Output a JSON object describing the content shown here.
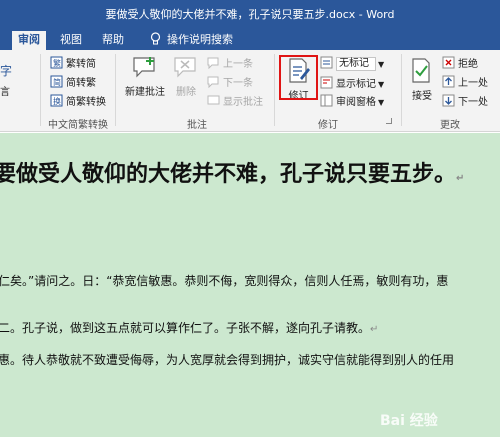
{
  "window": {
    "title": "要做受人敬仰的大佬并不难，孔子说只要五步.docx - Word"
  },
  "tabs": [
    {
      "label": "审阅",
      "active": true
    },
    {
      "label": "视图",
      "active": false
    },
    {
      "label": "帮助",
      "active": false
    }
  ],
  "tell_me": "操作说明搜索",
  "ribbon": {
    "left_partial": {
      "top": "字",
      "bottom": "言"
    },
    "chinese_conversion": {
      "items": [
        "繁转简",
        "简转繁",
        "简繁转换"
      ],
      "label": "中文简繁转换"
    },
    "comments": {
      "new_comment": "新建批注",
      "delete": "删除",
      "previous": "上一条",
      "next": "下一条",
      "show_comments": "显示批注",
      "label": "批注"
    },
    "tracking": {
      "track_changes": "修订",
      "markup_select": "无标记",
      "show_markup": "显示标记",
      "reviewing_pane": "审阅窗格",
      "label": "修订"
    },
    "changes": {
      "accept": "接受",
      "reject": "拒绝",
      "previous": "上一处",
      "next": "下一处",
      "label": "更改"
    }
  },
  "document": {
    "heading": "要做受人敬仰的大佬并不难，孔子说只要五步。",
    "para1": "仁矣。”请问之。日：“恭宽信敏惠。恭则不侮，宽则得众，信则人任焉，敏则有功，惠",
    "para2": "二。孔子说，做到这五点就可以算作仁了。子张不解，遂向孔子请教。",
    "para3": "惠。待人恭敬就不致遭受侮辱，为人宽厚就会得到拥护，诚实守信就能得到别人的任用"
  },
  "watermark": "Bai 经验",
  "colors": {
    "accent": "#2b579a",
    "doc_background": "#cce8cf",
    "highlight": "#e01414"
  }
}
